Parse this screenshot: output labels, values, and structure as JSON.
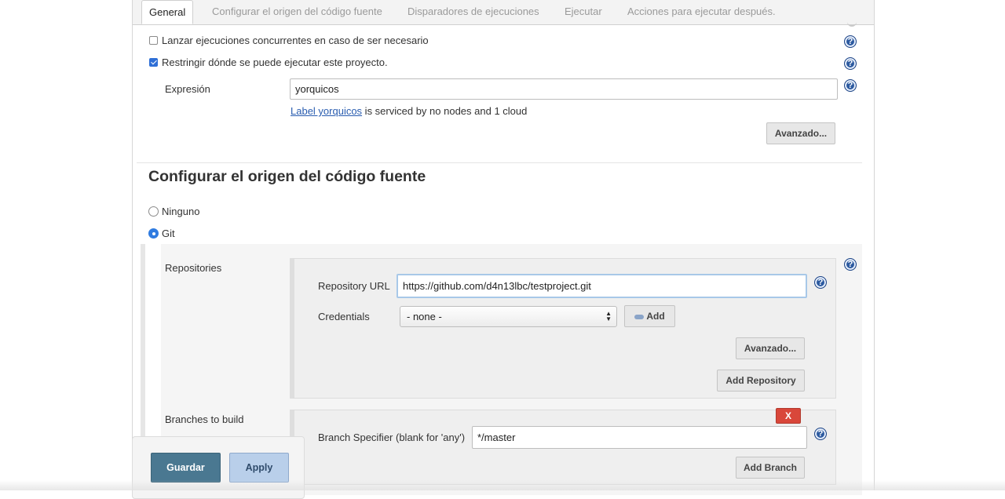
{
  "tabs": [
    {
      "label": "General",
      "active": true
    },
    {
      "label": "Configurar el origen del código fuente",
      "active": false
    },
    {
      "label": "Disparadores de ejecuciones",
      "active": false
    },
    {
      "label": "Ejecutar",
      "active": false
    },
    {
      "label": "Acciones para ejecutar después.",
      "active": false
    }
  ],
  "general": {
    "concurrent_label": "Lanzar ejecuciones concurrentes en caso de ser necesario",
    "concurrent_checked": false,
    "restrict_label": "Restringir dónde se puede ejecutar este proyecto.",
    "restrict_checked": true,
    "expression_label": "Expresión",
    "expression_value": "yorquicos",
    "label_link": "Label yorquicos",
    "label_info": " is serviced by no nodes and 1 cloud",
    "advanced_label": "Avanzado..."
  },
  "scm": {
    "heading": "Configurar el origen del código fuente",
    "none_label": "Ninguno",
    "git_label": "Git",
    "selected": "Git",
    "repositories_label": "Repositories",
    "repo_url_label": "Repository URL",
    "repo_url_value": "https://github.com/d4n13lbc/testproject.git",
    "credentials_label": "Credentials",
    "credentials_value": "- none -",
    "add_label": "Add",
    "advanced_label": "Avanzado...",
    "add_repository_label": "Add Repository",
    "branches_label": "Branches to build",
    "remove_label": "X",
    "branch_spec_label": "Branch Specifier (blank for 'any')",
    "branch_spec_value": "*/master",
    "add_branch_label": "Add Branch"
  },
  "actions": {
    "save_label": "Guardar",
    "apply_label": "Apply"
  },
  "icons": {
    "help": "help-icon",
    "key": "key-icon",
    "check": "check-icon"
  },
  "colors": {
    "primary_button": "#4a7891",
    "apply_button": "#b9cfea",
    "help": "#2c5aa0",
    "remove": "#d9473a",
    "link": "#2a5db0"
  }
}
